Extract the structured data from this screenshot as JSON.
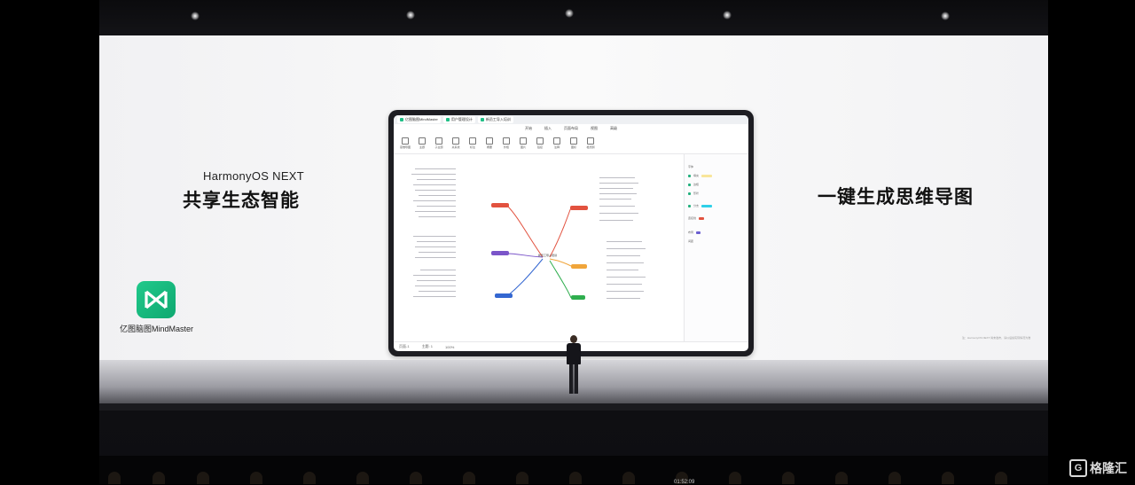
{
  "slide": {
    "brand": "HarmonyOS NEXT",
    "headline_left": "共享生态智能",
    "headline_right": "一键生成思维导图",
    "app_name": "亿图脑图MindMaster",
    "footnote": "注：HarmonyOS NEXT 尚未发布，请以后续实际情况为准"
  },
  "tablet": {
    "tabs": [
      "亿图脑图MindMaster",
      "用户管理设计",
      "新员工导入培训"
    ],
    "menus": [
      "开始",
      "插入",
      "页面布局",
      "视图",
      "高级"
    ],
    "tools": [
      "思维导图",
      "主题",
      "子主题",
      "关系线",
      "标注",
      "概要",
      "外框",
      "图片",
      "链接",
      "注释",
      "图标",
      "格式刷"
    ],
    "center_topic": "新员工导入培训",
    "panel_rows": [
      "字体",
      "填充",
      "边框",
      "形状",
      "分支",
      "连接线",
      "布局",
      "间距"
    ],
    "status": [
      "页面-1",
      "主题: 1",
      "100%"
    ]
  },
  "watermark": "格隆汇",
  "timer": "01:52:09",
  "colors": {
    "accent_green": "#1fbf86",
    "node_red": "#e2523f",
    "node_purple": "#7b55c9",
    "node_blue": "#3467d1",
    "node_orange": "#f0a53a",
    "node_green": "#2fae4e"
  }
}
